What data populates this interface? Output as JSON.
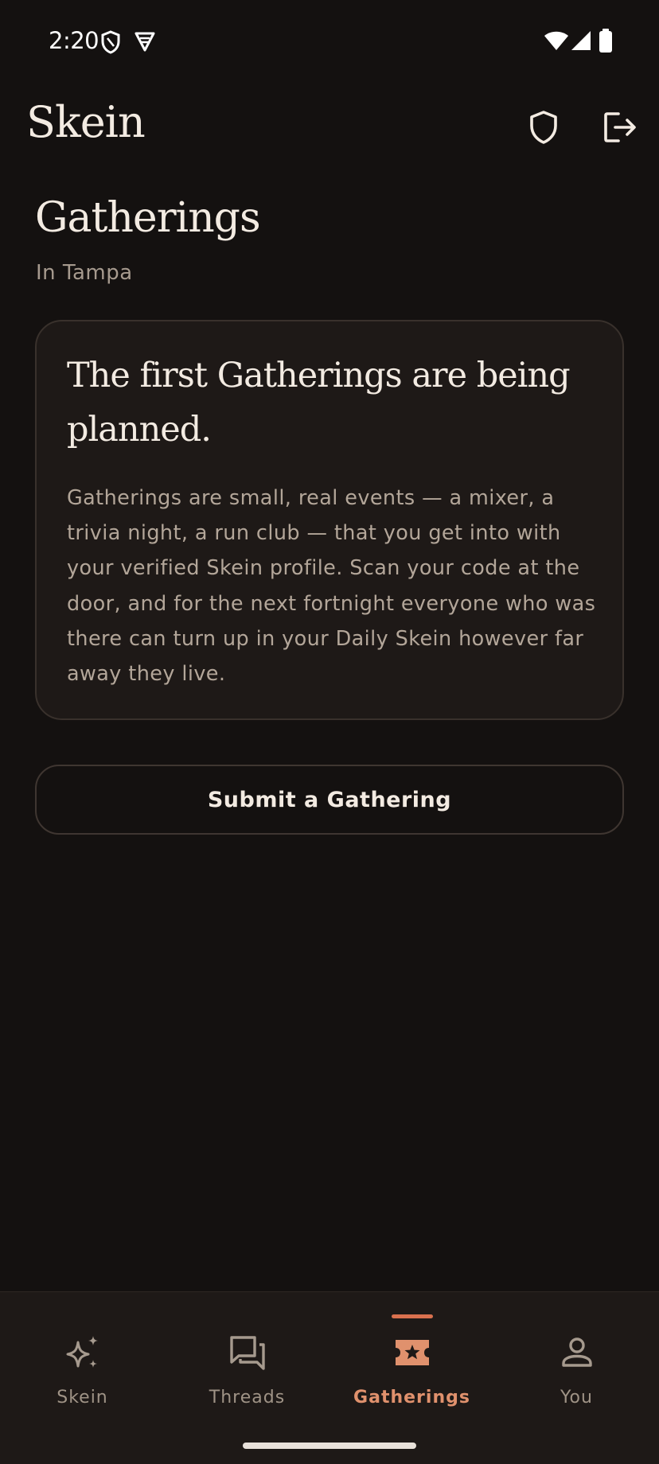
{
  "status_bar": {
    "time": "2:20"
  },
  "app_bar": {
    "title": "Skein",
    "actions": [
      "shield-icon",
      "logout-icon"
    ]
  },
  "page": {
    "title": "Gatherings",
    "subtitle": "In Tampa"
  },
  "info_card": {
    "heading": "The first Gatherings are being planned.",
    "body": "Gatherings are small, real events — a mixer, a trivia night, a run club — that you get into with your verified Skein profile. Scan your code at the door, and for the next fortnight everyone who was there can turn up in your Daily Skein however far away they live."
  },
  "actions": {
    "submit_label": "Submit a Gathering"
  },
  "bottom_nav": {
    "active_index": 2,
    "items": [
      {
        "label": "Skein",
        "icon": "sparkles-icon"
      },
      {
        "label": "Threads",
        "icon": "chat-bubbles-icon"
      },
      {
        "label": "Gatherings",
        "icon": "ticket-star-icon"
      },
      {
        "label": "You",
        "icon": "person-icon"
      }
    ]
  },
  "colors": {
    "background": "#141110",
    "card": "#1e1917",
    "accent": "#d9704e",
    "accent_text": "#e0916d",
    "muted_text": "#a69a8e"
  }
}
